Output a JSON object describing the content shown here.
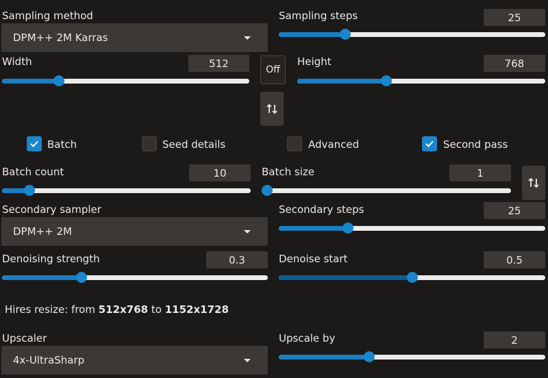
{
  "sampling": {
    "method_label": "Sampling method",
    "method_value": "DPM++ 2M Karras",
    "steps_label": "Sampling steps",
    "steps_value": "25",
    "steps_fraction": 0.25
  },
  "size": {
    "width_label": "Width",
    "width_value": "512",
    "width_fraction": 0.23,
    "height_label": "Height",
    "height_value": "768",
    "height_fraction": 0.36,
    "off_label": "Off",
    "swap_icon": "swap-vertical-arrows"
  },
  "toggles": {
    "batch_label": "Batch",
    "batch_checked": true,
    "seed_label": "Seed details",
    "seed_checked": false,
    "advanced_label": "Advanced",
    "advanced_checked": false,
    "second_pass_label": "Second pass",
    "second_pass_checked": true
  },
  "batch": {
    "count_label": "Batch count",
    "count_value": "10",
    "count_fraction": 0.11,
    "size_label": "Batch size",
    "size_value": "1",
    "size_fraction": 0.0
  },
  "secondary": {
    "sampler_label": "Secondary sampler",
    "sampler_value": "DPM++ 2M",
    "steps_label": "Secondary steps",
    "steps_value": "25",
    "steps_fraction": 0.26
  },
  "denoise": {
    "strength_label": "Denoising strength",
    "strength_value": "0.3",
    "strength_fraction": 0.3,
    "start_label": "Denoise start",
    "start_value": "0.5",
    "start_fraction": 0.5
  },
  "hires": {
    "prefix": "Hires resize: from",
    "from": "512x768",
    "to_word": "to",
    "to": "1152x1728"
  },
  "upscale": {
    "upscaler_label": "Upscaler",
    "upscaler_value": "4x-UltraSharp",
    "by_label": "Upscale by",
    "by_value": "2",
    "by_fraction": 0.34
  },
  "colors": {
    "accent": "#1a86cb",
    "background": "#1c1a19",
    "control": "#3b3836"
  }
}
